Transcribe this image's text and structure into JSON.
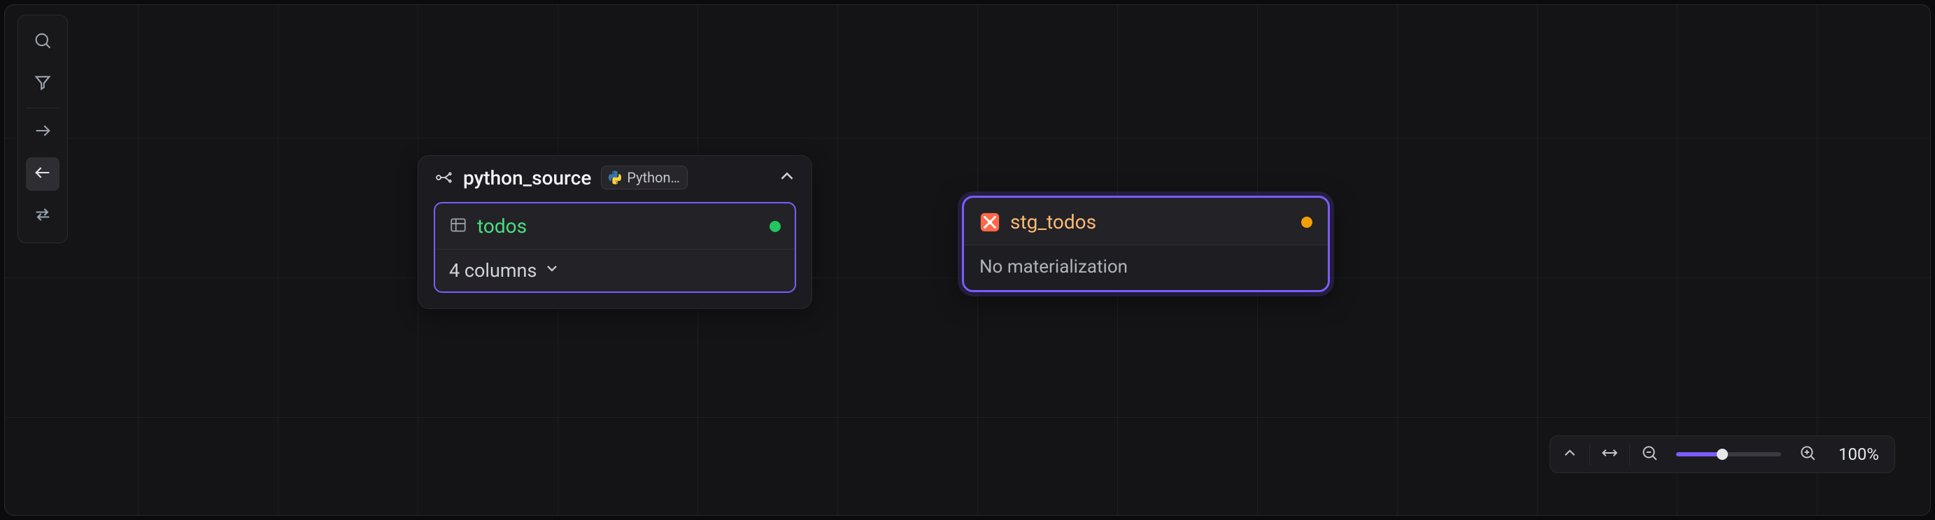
{
  "toolbar": {
    "buttons": [
      "search",
      "filter",
      "go_downstream",
      "go_upstream",
      "bidirectional"
    ],
    "active": "go_upstream"
  },
  "source_node": {
    "name": "python_source",
    "tag_label": "Python…",
    "asset": {
      "name": "todos",
      "status": "ok",
      "columns_label": "4 columns"
    }
  },
  "target_node": {
    "name": "stg_todos",
    "status": "stale",
    "subtitle": "No materialization"
  },
  "zoom": {
    "value_label": "100%",
    "percent": 44
  },
  "colors": {
    "accent": "#7c5cff",
    "success": "#22c55e",
    "warning": "#f59e0b",
    "model_name": "#fdba74",
    "asset_name": "#4ade80"
  }
}
